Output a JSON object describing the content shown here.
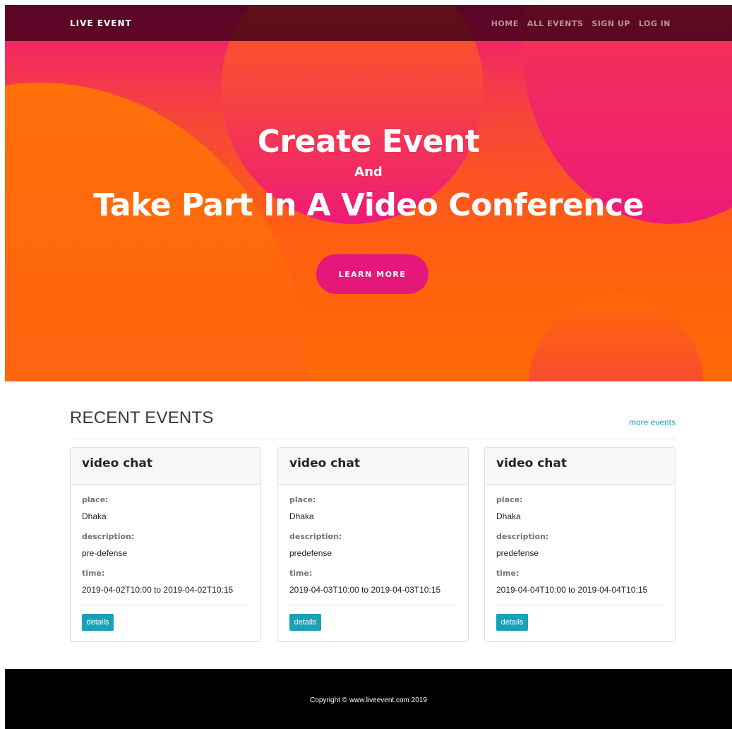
{
  "navbar": {
    "brand": "LIVE EVENT",
    "links": [
      "HOME",
      "ALL EVENTS",
      "SIGN UP",
      "LOG IN"
    ]
  },
  "hero": {
    "line1": "Create Event",
    "line2": "And",
    "line3": "Take Part In A Video Conference",
    "button": "LEARN MORE"
  },
  "recent": {
    "title": "RECENT EVENTS",
    "more_link": "more events",
    "labels": {
      "place": "place:",
      "description": "description:",
      "time": "time:"
    },
    "details_label": "details",
    "events": [
      {
        "title": "video chat",
        "place": "Dhaka",
        "description": "pre-defense",
        "time": "2019-04-02T10:00 to 2019-04-02T10:15"
      },
      {
        "title": "video chat",
        "place": "Dhaka",
        "description": "predefense",
        "time": "2019-04-03T10:00 to 2019-04-03T10:15"
      },
      {
        "title": "video chat",
        "place": "Dhaka",
        "description": "predefense",
        "time": "2019-04-04T10:00 to 2019-04-04T10:15"
      }
    ]
  },
  "footer": {
    "copyright": "Copyright © www.liveevent.com 2019"
  },
  "colors": {
    "navbar": "#3c0016",
    "accent_pink": "#e5177a",
    "accent_orange": "#ff6a05",
    "info": "#17a2b8",
    "footer": "#000000"
  }
}
